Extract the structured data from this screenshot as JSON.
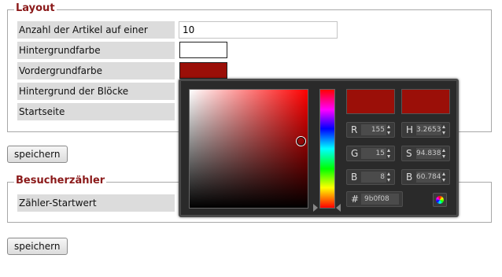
{
  "layout": {
    "legend": "Layout",
    "rows": [
      {
        "label": "Anzahl der Artikel auf einer Seite",
        "value": "10"
      },
      {
        "label": "Hintergrundfarbe",
        "color": "#ffffff"
      },
      {
        "label": "Vordergrundfarbe",
        "color": "#9b0f08"
      },
      {
        "label": "Hintergrund der Blöcke"
      },
      {
        "label": "Startseite"
      }
    ],
    "save_label": "speichern"
  },
  "counter": {
    "legend": "Besucherzähler",
    "rows": [
      {
        "label": "Zähler-Startwert"
      }
    ],
    "save_label": "speichern"
  },
  "colorpicker": {
    "new_color": "#9b0f08",
    "current_color": "#9b0f08",
    "fields": {
      "r": {
        "label": "R",
        "value": "155"
      },
      "g": {
        "label": "G",
        "value": "15"
      },
      "b": {
        "label": "B",
        "value": "8"
      },
      "h": {
        "label": "H",
        "value": "3.2653"
      },
      "s": {
        "label": "S",
        "value": "94.838"
      },
      "bv": {
        "label": "B",
        "value": "60.784"
      }
    },
    "hex_label": "#",
    "hex_value": "9b0f08",
    "icons": [
      "spinner-icon",
      "color-wheel-icon"
    ]
  }
}
